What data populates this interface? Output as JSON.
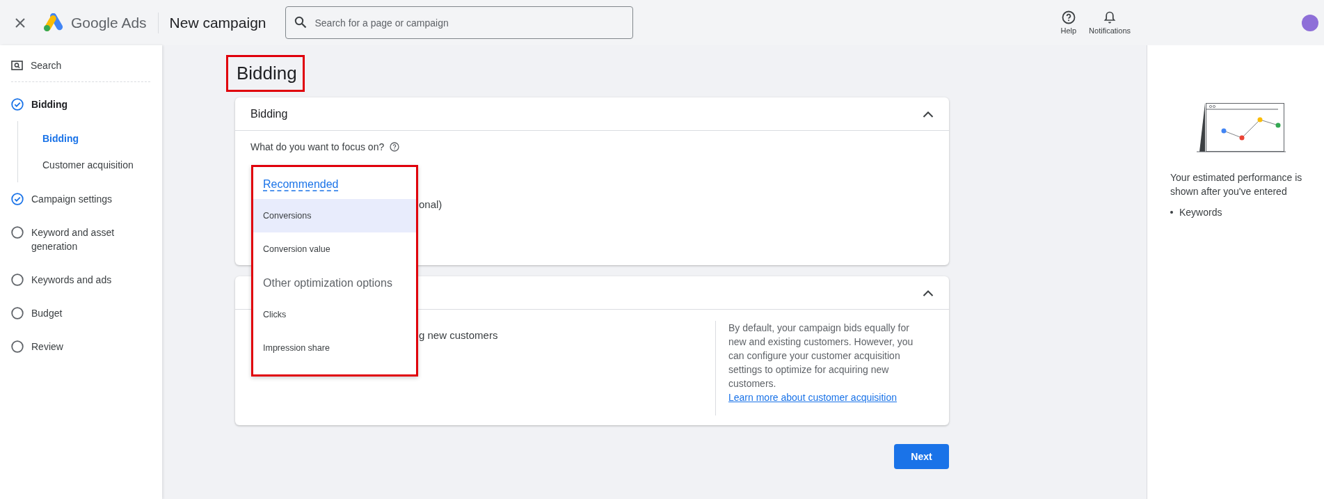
{
  "topbar": {
    "product": "Google Ads",
    "page": "New campaign",
    "search": {
      "placeholder": "Search for a page or campaign"
    },
    "actions": [
      {
        "kind": "help",
        "label": "Help"
      },
      {
        "kind": "notifications",
        "label": "Notifications"
      }
    ]
  },
  "sidebar": {
    "campaign_type": "Search",
    "steps": [
      {
        "label": "Bidding",
        "completed": true,
        "selected": true,
        "children": [
          {
            "label": "Bidding",
            "selected": true
          },
          {
            "label": "Customer acquisition",
            "selected": false
          }
        ]
      },
      {
        "label": "Campaign settings",
        "completed": true,
        "selected": false
      },
      {
        "label": "Keyword and asset generation",
        "completed": false,
        "selected": false
      },
      {
        "label": "Keywords and ads",
        "completed": false,
        "selected": false
      },
      {
        "label": "Budget",
        "completed": false,
        "selected": false
      },
      {
        "label": "Review",
        "completed": false,
        "selected": false
      }
    ]
  },
  "main": {
    "title": {
      "text": "Bidding",
      "highlighted": true
    },
    "cards": [
      {
        "title": "Bidding",
        "expanded": true,
        "question": "What do you want to focus on?",
        "partial_text": "onal)"
      },
      {
        "expanded": true,
        "partial_text": "g new customers",
        "description": {
          "text": "By default, your campaign bids equally for new and existing customers. However, you can configure your customer acquisition settings to optimize for acquiring new customers.",
          "link": "Learn more about customer acquisition"
        }
      }
    ],
    "focus_menu": {
      "highlighted": true,
      "items": [
        {
          "kind": "group",
          "label": "Recommended"
        },
        {
          "kind": "option",
          "label": "Conversions",
          "selected": true
        },
        {
          "kind": "option",
          "label": "Conversion value",
          "selected": false
        },
        {
          "kind": "group",
          "label": "Other optimization options"
        },
        {
          "kind": "option",
          "label": "Clicks",
          "selected": false
        },
        {
          "kind": "option",
          "label": "Impression share",
          "selected": false
        }
      ]
    },
    "next_button": "Next"
  },
  "side_panel": {
    "text": "Your estimated performance is shown after you've entered",
    "bullets": [
      "Keywords"
    ]
  }
}
